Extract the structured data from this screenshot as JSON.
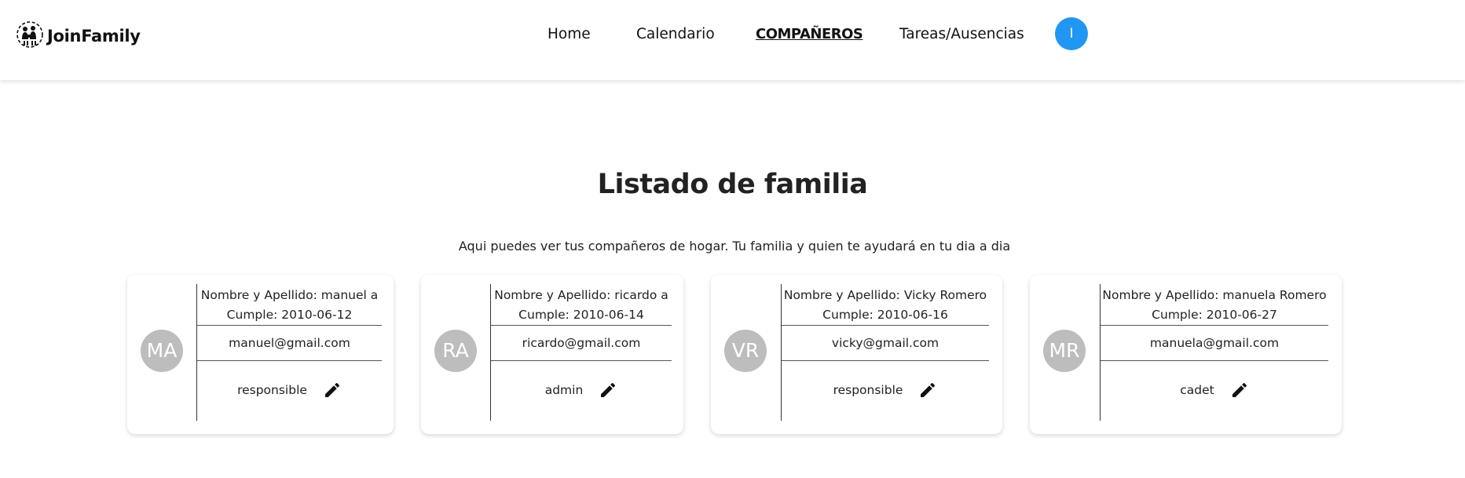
{
  "app": {
    "name": "JoinFamily"
  },
  "nav": {
    "items": [
      {
        "label": "Home"
      },
      {
        "label": "Calendario"
      },
      {
        "label": "COMPAÑEROS"
      },
      {
        "label": "Tareas/Ausencias"
      }
    ],
    "active": "COMPAÑEROS",
    "user_initial": "I",
    "user_color": "#2196f3"
  },
  "main": {
    "title": "Listado de familia",
    "subtitle": "Aqui puedes ver tus compañeros de hogar. Tu familia y quien te ayudará en tu dia a dia"
  },
  "members": [
    {
      "initials": "MA",
      "name_line": "Nombre y Apellido: manuel a",
      "birthday_line": "Cumple: 2010-06-12",
      "email": "manuel@gmail.com",
      "role": "responsible"
    },
    {
      "initials": "RA",
      "name_line": "Nombre y Apellido: ricardo a",
      "birthday_line": "Cumple: 2010-06-14",
      "email": "ricardo@gmail.com",
      "role": "admin"
    },
    {
      "initials": "VR",
      "name_line": "Nombre y Apellido: Vicky Romero",
      "birthday_line": "Cumple: 2010-06-16",
      "email": "vicky@gmail.com",
      "role": "responsible"
    },
    {
      "initials": "MR",
      "name_line": "Nombre y Apellido: manuela Romero",
      "birthday_line": "Cumple: 2010-06-27",
      "email": "manuela@gmail.com",
      "role": "cadet"
    }
  ],
  "colors": {
    "avatar_bg": "#bdbdbd",
    "accent": "#2196f3"
  },
  "icons": {
    "logo": "family-logo-icon",
    "edit": "pencil-edit-icon"
  }
}
